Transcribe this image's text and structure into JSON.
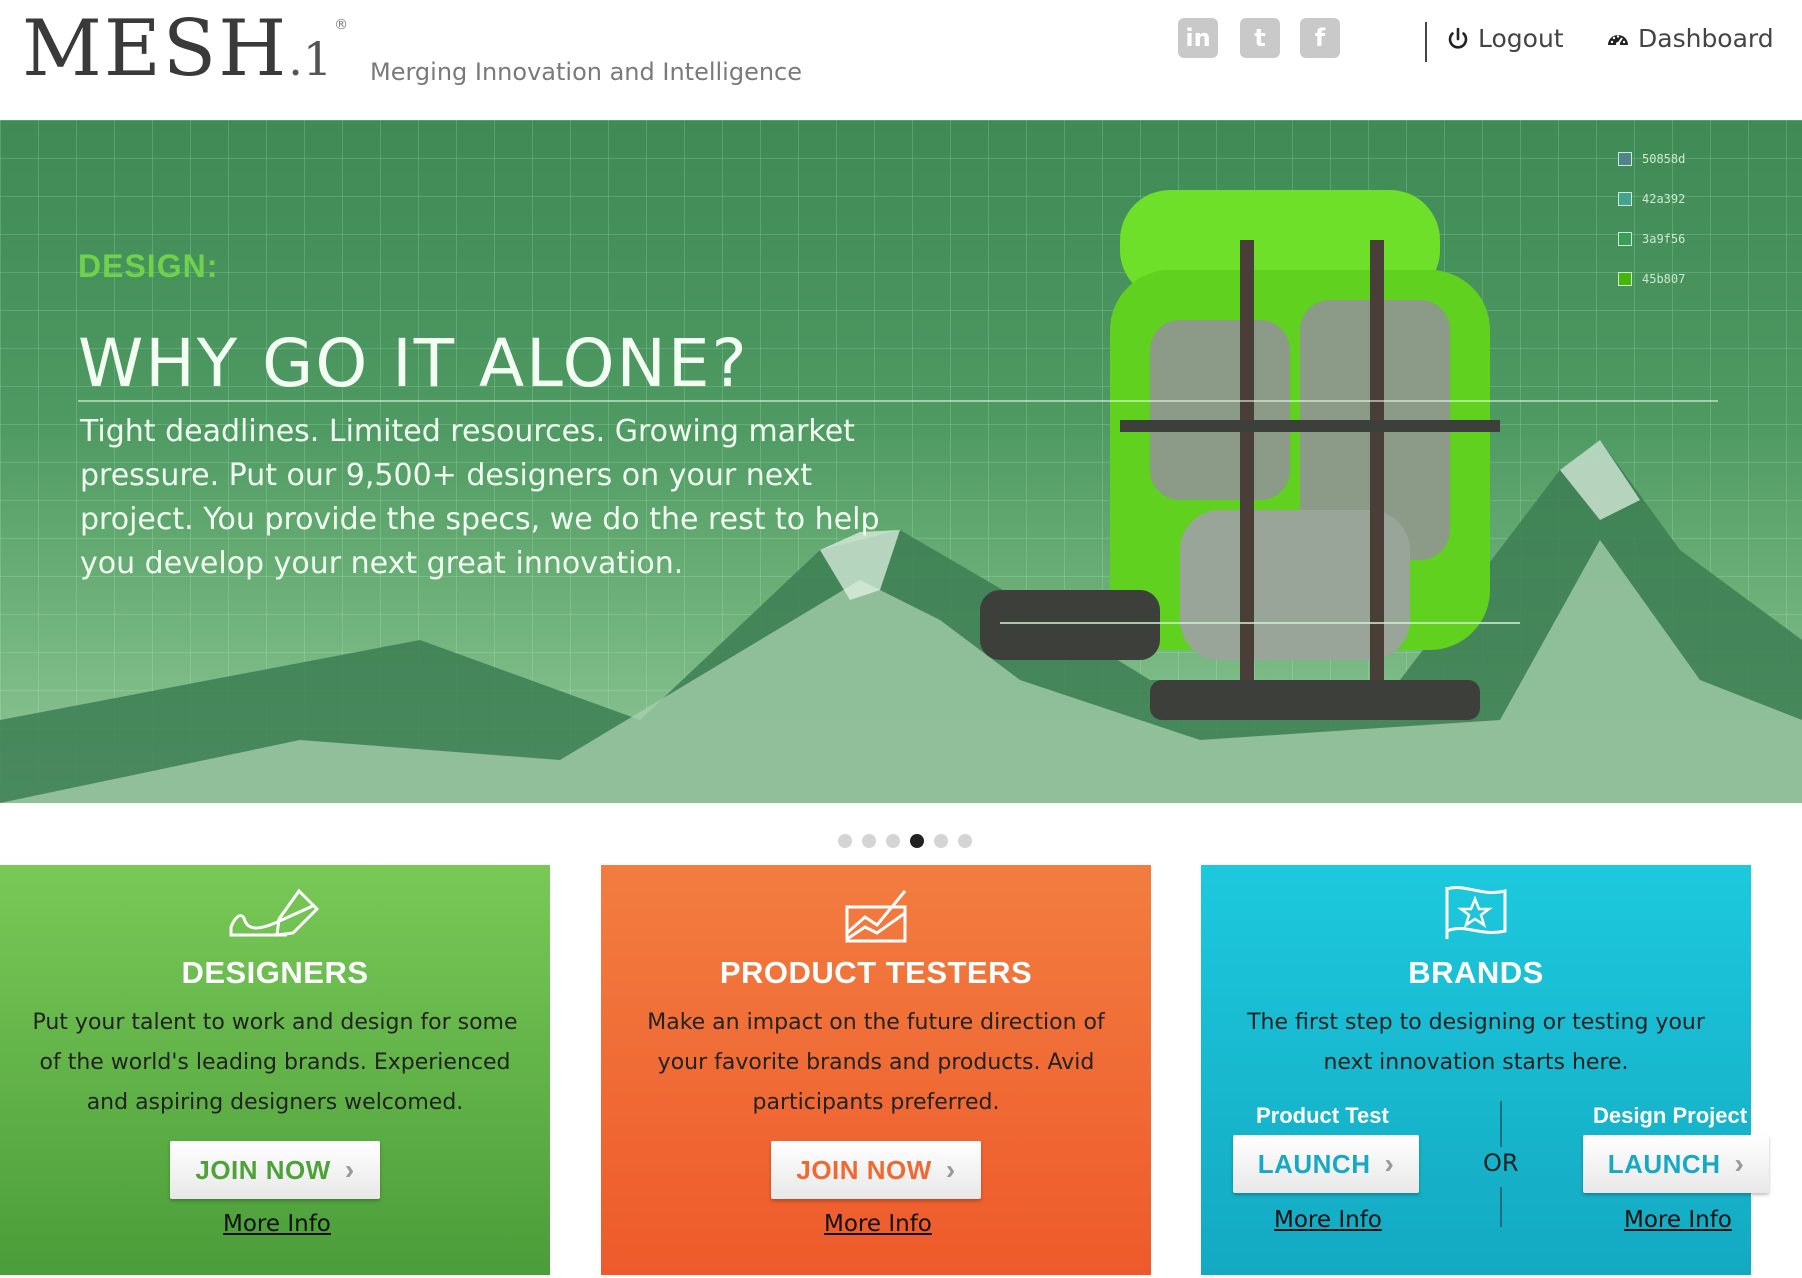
{
  "header": {
    "logo_main": "MESH",
    "logo_sub": ".1",
    "logo_reg": "®",
    "tagline": "Merging Innovation and Intelligence",
    "social": [
      {
        "name": "linkedin-icon",
        "glyph": "in"
      },
      {
        "name": "twitter-icon",
        "glyph": "t"
      },
      {
        "name": "facebook-icon",
        "glyph": "f"
      }
    ],
    "logout_label": "Logout",
    "dashboard_label": "Dashboard"
  },
  "hero": {
    "kicker": "DESIGN:",
    "title": "WHY GO IT ALONE?",
    "body": "Tight deadlines. Limited resources. Growing market pressure. Put our 9,500+ designers on your next project. You provide the specs, we do the rest to help you develop your next great innovation.",
    "swatches": [
      {
        "code": "50858d",
        "color": "#50858d"
      },
      {
        "code": "42a392",
        "color": "#42a392"
      },
      {
        "code": "3a9f56",
        "color": "#3a9f56"
      },
      {
        "code": "45b807",
        "color": "#45b807"
      }
    ]
  },
  "carousel": {
    "count": 6,
    "active_index": 3
  },
  "cards": {
    "designers": {
      "title": "DESIGNERS",
      "text": "Put your talent to work and design for some of the world's leading brands. Experienced and aspiring designers welcomed.",
      "button": "JOIN NOW",
      "more": "More Info",
      "accent": "#4fa23a"
    },
    "testers": {
      "title": "PRODUCT TESTERS",
      "text": "Make an impact on the future direction of your favorite brands and products. Avid participants preferred.",
      "button": "JOIN NOW",
      "more": "More Info",
      "accent": "#ee6a32"
    },
    "brands": {
      "title": "BRANDS",
      "text": "The first step to designing or testing your next innovation starts here.",
      "product_test_label": "Product Test",
      "design_project_label": "Design Project",
      "launch_label": "LAUNCH",
      "or_label": "OR",
      "more": "More Info",
      "accent": "#17a9c3"
    }
  }
}
